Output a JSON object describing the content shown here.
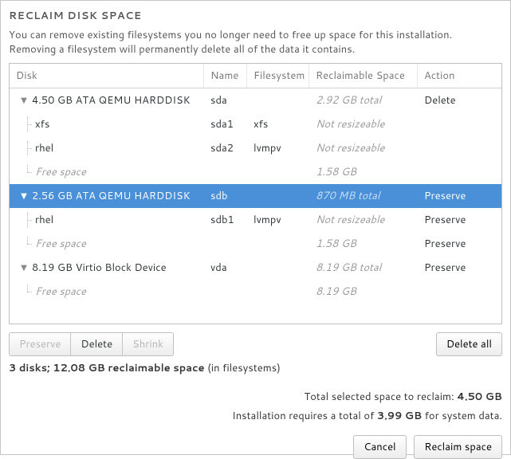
{
  "title": "RECLAIM DISK SPACE",
  "description_line1": "You can remove existing filesystems you no longer need to free up space for this installation.",
  "description_line2": "Removing a filesystem will permanently delete all of the data it contains.",
  "columns": {
    "disk": "Disk",
    "name": "Name",
    "filesystem": "Filesystem",
    "reclaimable": "Reclaimable Space",
    "action": "Action"
  },
  "rows": [
    {
      "indent": 0,
      "expander": "▼",
      "disk": "4.50 GB ATA QEMU HARDDISK",
      "name": "sda",
      "fs": "",
      "recl": "2.92 GB total",
      "recl_muted": true,
      "action": "Delete",
      "selected": false,
      "treeClass": ""
    },
    {
      "indent": 1,
      "expander": "",
      "disk": "xfs",
      "name": "sda1",
      "fs": "xfs",
      "recl": "Not resizeable",
      "recl_muted": true,
      "action": "",
      "selected": false,
      "treeClass": "mid"
    },
    {
      "indent": 1,
      "expander": "",
      "disk": "rhel",
      "name": "sda2",
      "fs": "lvmpv",
      "recl": "Not resizeable",
      "recl_muted": true,
      "action": "",
      "selected": false,
      "treeClass": "mid"
    },
    {
      "indent": 1,
      "expander": "",
      "disk": "Free space",
      "disk_muted": true,
      "name": "",
      "fs": "",
      "recl": "1.58 GB",
      "recl_muted": true,
      "action": "",
      "selected": false,
      "treeClass": ""
    },
    {
      "indent": 0,
      "expander": "▼",
      "disk": "2.56 GB ATA QEMU HARDDISK",
      "name": "sdb",
      "fs": "",
      "recl": "870 MB total",
      "recl_muted": true,
      "action": "Preserve",
      "selected": true,
      "treeClass": ""
    },
    {
      "indent": 1,
      "expander": "",
      "disk": "rhel",
      "name": "sdb1",
      "fs": "lvmpv",
      "recl": "Not resizeable",
      "recl_muted": true,
      "action": "Preserve",
      "selected": false,
      "treeClass": "mid"
    },
    {
      "indent": 1,
      "expander": "",
      "disk": "Free space",
      "disk_muted": true,
      "name": "",
      "fs": "",
      "recl": "1.58 GB",
      "recl_muted": true,
      "action": "Preserve",
      "selected": false,
      "treeClass": ""
    },
    {
      "indent": 0,
      "expander": "▼",
      "disk": "8.19 GB Virtio Block Device",
      "name": "vda",
      "fs": "",
      "recl": "8.19 GB total",
      "recl_muted": true,
      "action": "Preserve",
      "selected": false,
      "treeClass": ""
    },
    {
      "indent": 1,
      "expander": "",
      "disk": "Free space",
      "disk_muted": true,
      "name": "",
      "fs": "",
      "recl": "8.19 GB",
      "recl_muted": true,
      "action": "",
      "selected": false,
      "treeClass": ""
    }
  ],
  "buttons": {
    "preserve": "Preserve",
    "delete": "Delete",
    "shrink": "Shrink",
    "delete_all": "Delete all",
    "cancel": "Cancel",
    "reclaim": "Reclaim space"
  },
  "summary_bold": "3 disks; 12.08 GB reclaimable space",
  "summary_rest": " (in filesystems)",
  "total_label": "Total selected space to reclaim: ",
  "total_value": "4.50 GB",
  "install_prefix": "Installation requires a total of ",
  "install_value": "3.99 GB",
  "install_suffix": " for system data."
}
